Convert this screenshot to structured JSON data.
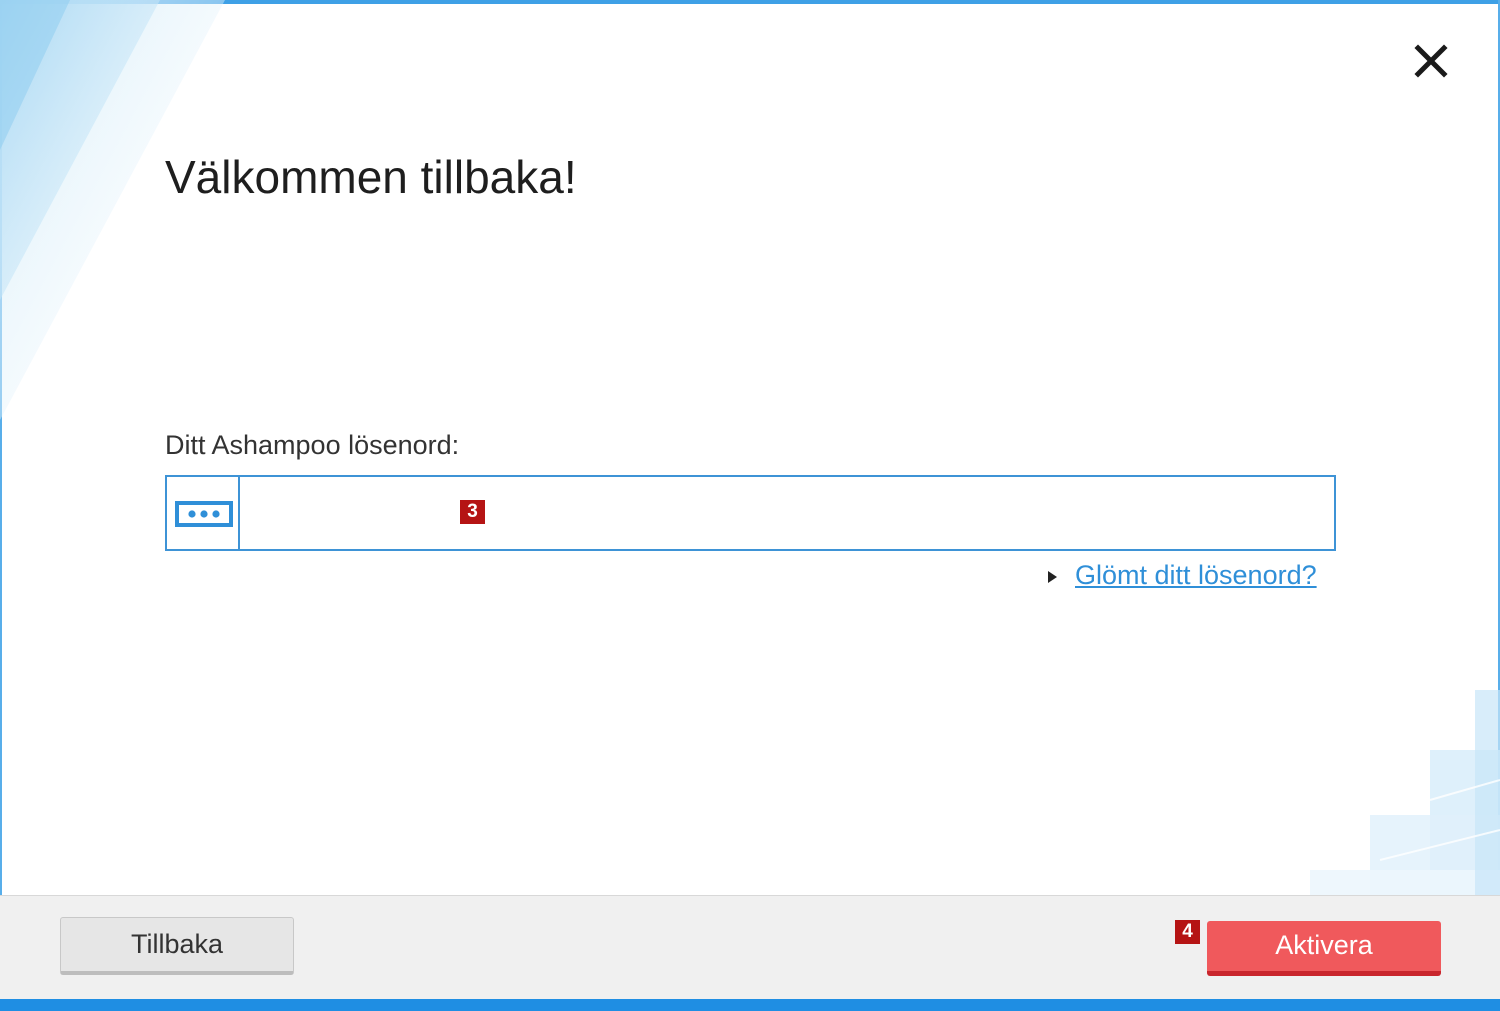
{
  "window": {
    "title": "Välkommen tillbaka!",
    "close_icon": "close-icon"
  },
  "form": {
    "password_label": "Ditt Ashampoo lösenord:",
    "password_value": "",
    "password_icon": "password-dots-icon",
    "forgot_link": "Glömt ditt lösenord?"
  },
  "annotations": {
    "badge_password": "3",
    "badge_activate": "4"
  },
  "footer": {
    "back_label": "Tillbaka",
    "activate_label": "Aktivera"
  },
  "colors": {
    "accent_blue": "#3e93d6",
    "link_blue": "#2f8fd8",
    "activate_red": "#f0595c",
    "badge_red": "#b51414",
    "bottom_bar": "#1f8ee3"
  }
}
